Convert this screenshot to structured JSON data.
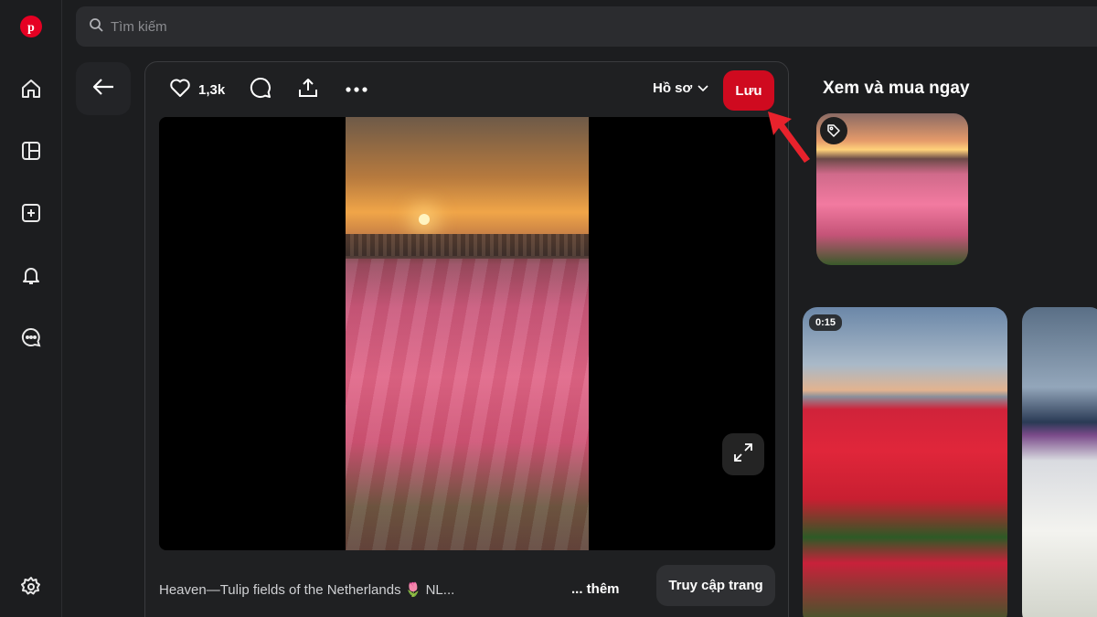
{
  "nav": {
    "items": [
      {
        "name": "home",
        "icon": "home-icon"
      },
      {
        "name": "board",
        "icon": "layout-icon"
      },
      {
        "name": "create",
        "icon": "plus-square-icon"
      },
      {
        "name": "notifications",
        "icon": "bell-icon"
      },
      {
        "name": "messages",
        "icon": "chat-icon"
      }
    ],
    "settings_icon": "gear-icon",
    "brand_color": "#e60023"
  },
  "search": {
    "placeholder": "Tìm kiếm"
  },
  "pin": {
    "like_count": "1,3k",
    "board_label": "Hồ sơ",
    "save_label": "Lưu",
    "save_color": "#cf0a1f",
    "description": "Heaven—Tulip fields of the Netherlands 🌷 NL...",
    "more_label": "... thêm",
    "visit_label": "Truy cập trang"
  },
  "sidebar": {
    "shop_title": "Xem và mua ngay",
    "related": [
      {
        "duration": "0:15"
      }
    ]
  },
  "annotation": {
    "color": "#e8222c"
  }
}
